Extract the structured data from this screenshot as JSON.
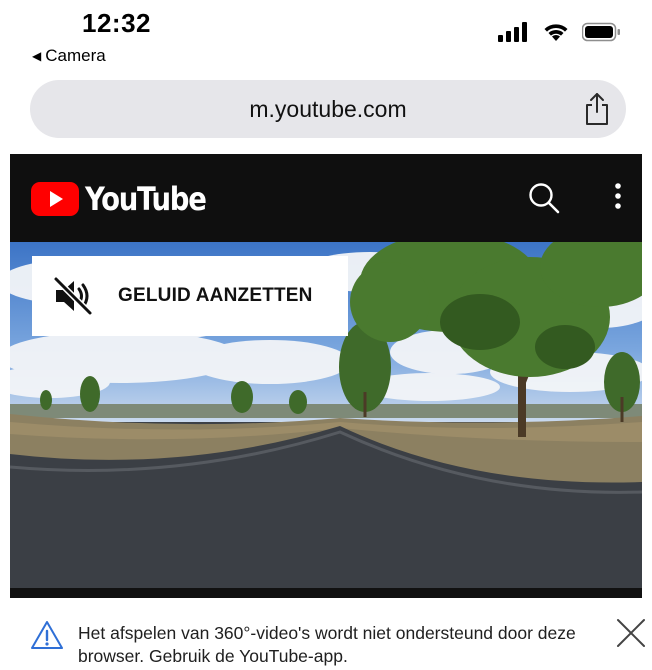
{
  "status_bar": {
    "time": "12:32",
    "back_label": "Camera",
    "icons": [
      "cellular-signal-icon",
      "wifi-icon",
      "battery-icon"
    ]
  },
  "browser": {
    "url": "m.youtube.com",
    "share_icon": "share-icon"
  },
  "youtube": {
    "logo_text": "YouTube",
    "brand_color": "#ff0000",
    "icons": [
      "search-icon",
      "more-vertical-icon"
    ]
  },
  "video": {
    "unmute_label": "GELUID AANZETTEN",
    "mute_icon": "speaker-muted-icon"
  },
  "notice": {
    "text": "Het afspelen van 360°-video's wordt niet ondersteund door deze browser. Gebruik de YouTube-app.",
    "icon": "warning-icon",
    "close_icon": "close-icon"
  }
}
